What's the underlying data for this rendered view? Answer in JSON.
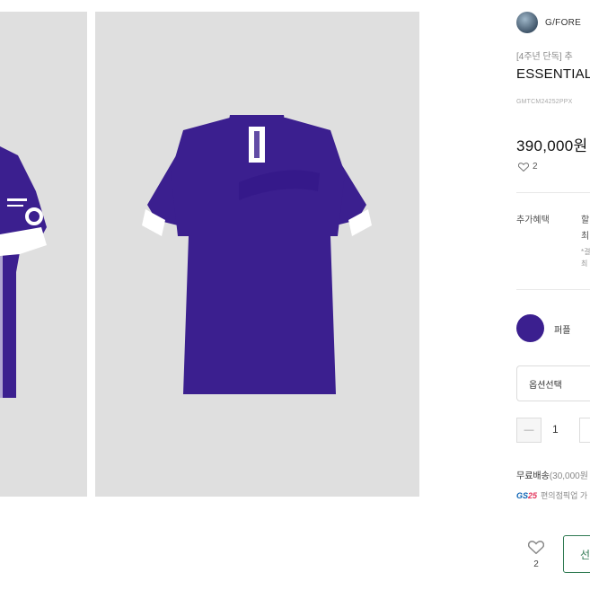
{
  "brand": {
    "name": "G/FORE",
    "logo_icon": "brand-avatar-icon"
  },
  "product": {
    "subtitle": "[4주년 단독] 추",
    "title": "ESSENTIAL",
    "code": "GMTCM24252PPX",
    "price": "390,000원",
    "likes": "2"
  },
  "benefits": {
    "label": "추가혜택",
    "line1": "할",
    "line2": "최",
    "note1": "*결",
    "note2": "최"
  },
  "color_option": {
    "label": "퍼플",
    "swatch_color": "#3b1f8f"
  },
  "option_select": {
    "placeholder": "옵션선택"
  },
  "quantity": {
    "minus_label": "—",
    "value": "1"
  },
  "shipping": {
    "label": "무료배송",
    "detail": "(30,000원"
  },
  "gs25": {
    "logo": "GS",
    "logo_num": "25",
    "text": "편의점픽업 가"
  },
  "bottom_bar": {
    "likes": "2",
    "buy_label": "선"
  },
  "colors": {
    "accent": "#2f7a52",
    "product_purple": "#3b1f8f",
    "gallery_bg": "#dfdfdf"
  }
}
